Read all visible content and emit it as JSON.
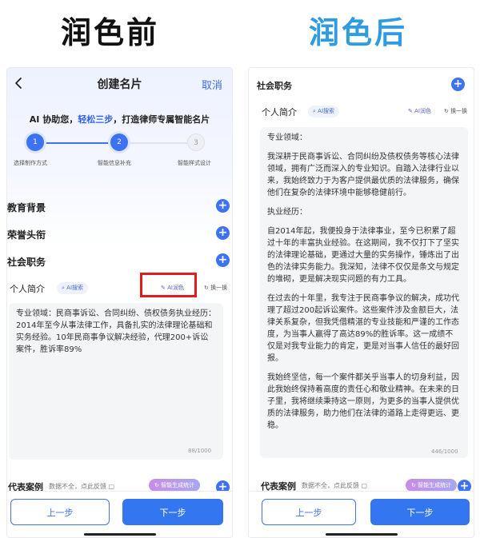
{
  "headings": {
    "before": "润色前",
    "after": "润色后"
  },
  "left": {
    "nav": {
      "title": "创建名片",
      "cancel": "取消"
    },
    "tagline": {
      "pre": "AI 协助您，",
      "em": "轻松三步",
      "post": "，打造律师专属智能名片"
    },
    "steps": [
      {
        "num": "1",
        "label": "选择制作方式"
      },
      {
        "num": "2",
        "label": "智能信息补充"
      },
      {
        "num": "3",
        "label": "智能样式设计"
      }
    ],
    "sections": [
      "教育背景",
      "荣誉头衔",
      "社会职务"
    ],
    "intro": {
      "label": "个人简介",
      "search": "AI搜索",
      "polish": "AI润色",
      "swap": "换一换"
    },
    "text": "专业领域：民商事诉讼、合同纠纷、债权债务执业经历：2014年至今从事法律工作，具备扎实的法律理论基础和实务经验。10年民商事争议解决经验，代理200+诉讼案件，胜诉率89%",
    "counter": "88/1000",
    "cases": {
      "label": "代表案例",
      "note": "数据不全，点此反馈",
      "stat": "智能生成统计"
    },
    "footer": {
      "prev": "上一步",
      "next": "下一步"
    }
  },
  "right": {
    "top_section": "社会职务",
    "intro": {
      "label": "个人简介",
      "search": "AI搜索",
      "polish": "AI润色",
      "swap": "换一换"
    },
    "paragraphs": [
      "专业领域：",
      "我深耕于民商事诉讼、合同纠纷及债权债务等核心法律领域，拥有广泛而深入的专业知识。自踏入法律行业以来，我始终致力于为客户提供最优质的法律服务，确保他们在复杂的法律环境中能够稳健前行。",
      "执业经历：",
      "自2014年起，我便投身于法律事业，至今已积累了超过十年的丰富执业经验。在这期间，我不仅打下了坚实的法律理论基础，更通过大量的实务操作，锤炼出了出色的法律实务能力。我深知，法律不仅仅是条文与规定的堆砌，更是解决现实问题的有力工具。",
      "在过去的十年里，我专注于民商事争议的解决，成功代理了超过200起诉讼案件。这些案件涉及金额巨大，法律关系复杂，但我凭借精湛的专业技能和严谨的工作态度，为当事人赢得了高达89%的胜诉率。这一成绩不仅是对我专业能力的肯定，更是对当事人信任的最好回报。",
      "我始终坚信，每一个案件都关乎当事人的切身利益，因此我始终保持着高度的责任心和敬业精神。在未来的日子里，我将继续秉持这一原则，为更多的当事人提供优质的法律服务，助力他们在法律的道路上走得更远、更稳。"
    ],
    "counter": "446/1000",
    "cases": {
      "label": "代表案例",
      "note": "数据不全，点此反馈",
      "stat": "智能生成统计"
    },
    "footer": {
      "prev": "上一步",
      "next": "下一步"
    }
  },
  "colors": {
    "accent": "#3476f0",
    "after_heading": "#2f9be0",
    "highlight": "#e01c1c"
  },
  "icons": [
    "back-chevron-icon",
    "plus-icon",
    "search-icon",
    "wand-icon",
    "refresh-icon",
    "feedback-icon"
  ]
}
